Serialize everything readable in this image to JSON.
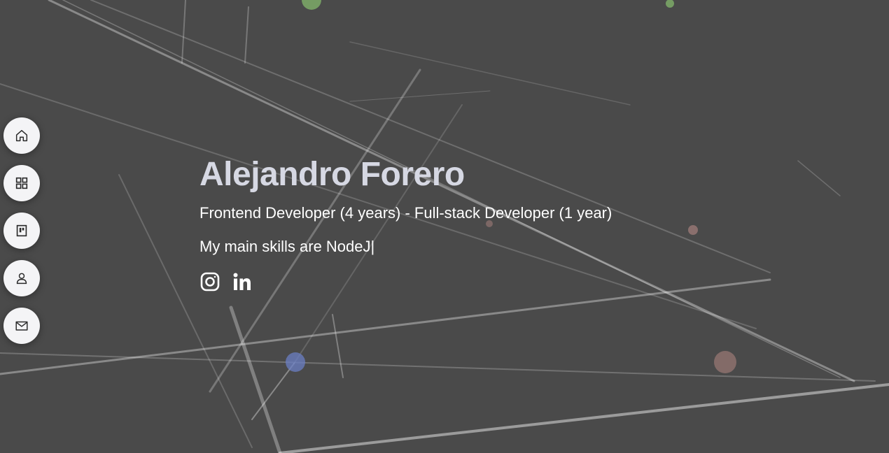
{
  "hero": {
    "name": "Alejandro Forero",
    "role": "Frontend Developer (4 years) - Full-stack Developer (1 year)",
    "skills": "My main skills are NodeJ|"
  },
  "nav": [
    {
      "icon": "home-icon"
    },
    {
      "icon": "grid-icon"
    },
    {
      "icon": "board-icon"
    },
    {
      "icon": "user-icon"
    },
    {
      "icon": "mail-icon"
    }
  ],
  "social": [
    {
      "icon": "instagram-icon"
    },
    {
      "icon": "linkedin-icon"
    }
  ],
  "colors": {
    "background": "#4a4a4a",
    "name": "#d6d8e3",
    "text": "#ffffff",
    "nav_button": "#f4f4f6"
  }
}
